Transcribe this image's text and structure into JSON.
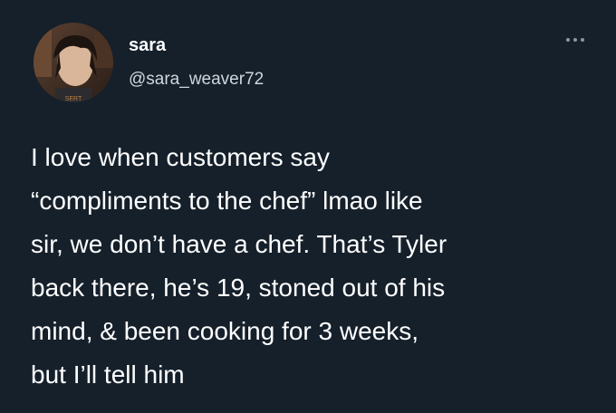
{
  "author": {
    "name": "sara",
    "handle": "@sara_weaver72"
  },
  "icons": {
    "avatar": "profile-photo",
    "more": "more-horizontal-icon"
  },
  "tweet": {
    "lines": [
      "I love when customers say",
      "“compliments to the chef” lmao like",
      "sir, we don’t have a chef. That’s Tyler",
      "back there, he’s 19, stoned out of his",
      "mind, & been cooking for 3 weeks,",
      "but I’ll tell him"
    ]
  },
  "colors": {
    "background": "#15202b",
    "text": "#ffffff",
    "handle": "#d0d6dc",
    "icon": "#8899a6"
  }
}
